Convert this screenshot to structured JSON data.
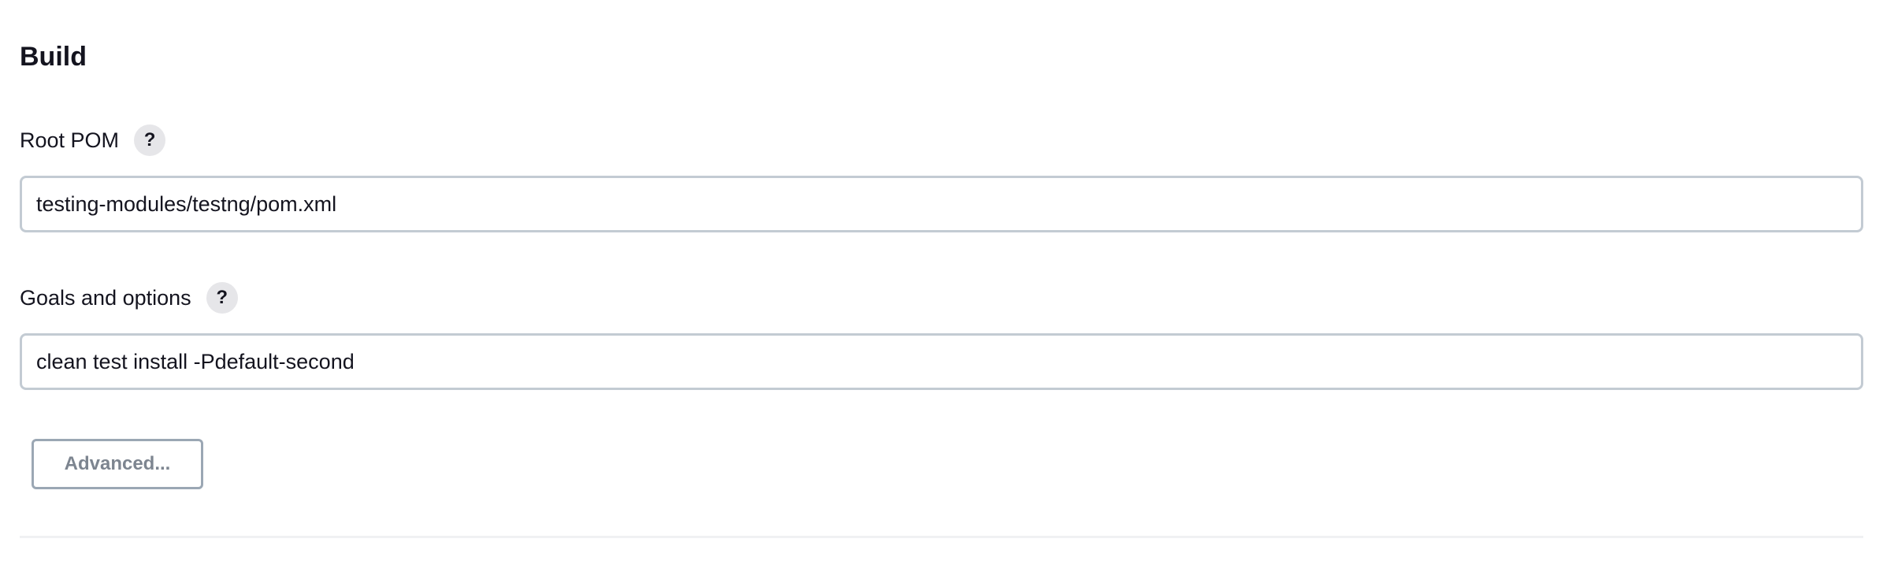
{
  "section": {
    "title": "Build"
  },
  "fields": {
    "root_pom": {
      "label": "Root POM",
      "help": "?",
      "value": "testing-modules/testng/pom.xml"
    },
    "goals": {
      "label": "Goals and options",
      "help": "?",
      "value": "clean test install -Pdefault-second"
    }
  },
  "buttons": {
    "advanced_label": "Advanced..."
  },
  "icons": {
    "help": "help-icon"
  },
  "colors": {
    "input_border": "#c3cbd3",
    "help_bg": "#e6e6e9",
    "button_border": "#9ba7b4",
    "button_text": "#7d8590",
    "text": "#14141f"
  }
}
